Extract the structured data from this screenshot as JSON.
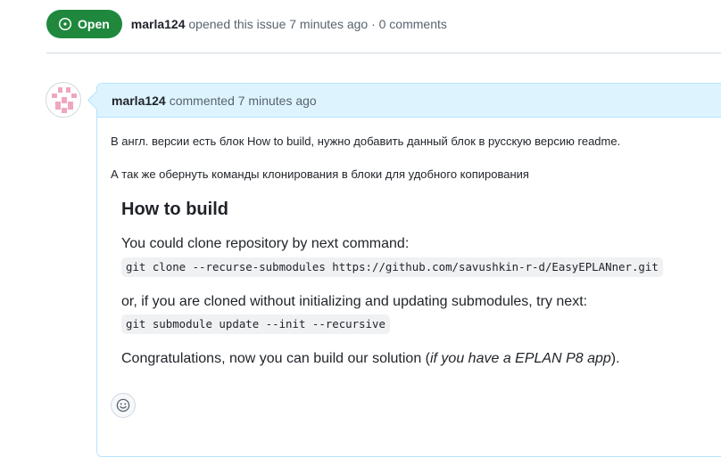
{
  "issue": {
    "state_label": "Open",
    "author": "marla124",
    "meta_text": "opened this issue 7 minutes ago · 0 comments"
  },
  "comment": {
    "author": "marla124",
    "action_text": "commented 7 minutes ago",
    "paragraphs": [
      "В англ. версии есть блок How to build, нужно добавить данный блок в русскую версию readme.",
      "А так же обернуть команды клонирования в блоки для удобного копирования"
    ],
    "quoted": {
      "heading": "How to build",
      "line1": "You could clone repository by next command:",
      "code1": "git clone --recurse-submodules https://github.com/savushkin-r-d/EasyEPLANner.git",
      "line2": "or, if you are cloned without initializing and updating submodules, try next:",
      "code2": "git submodule update --init --recursive",
      "line3_prefix": "Congratulations, now you can build our solution (",
      "line3_italic": "if you have a EPLAN P8 app",
      "line3_suffix": ")."
    }
  },
  "icons": {
    "state": "issue-opened-icon",
    "reaction": "smiley-icon"
  },
  "colors": {
    "open_green": "#1f883d",
    "comment_header_bg": "#ddf4ff",
    "comment_border": "#b6e3ff",
    "avatar_pink": "#f0a7bd"
  }
}
